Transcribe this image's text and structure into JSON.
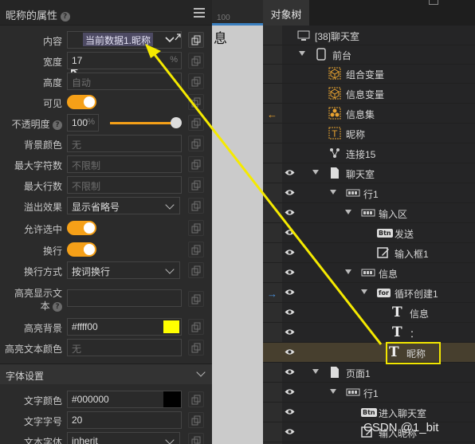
{
  "props": {
    "title": "昵称的属性",
    "rows": {
      "content": {
        "label": "内容",
        "chip": "当前数据1.昵称"
      },
      "width": {
        "label": "宽度",
        "value": "17",
        "unit": "%"
      },
      "height": {
        "label": "高度",
        "placeholder": "自动"
      },
      "visible": {
        "label": "可见"
      },
      "opacity": {
        "label": "不透明度",
        "value": "100",
        "unit": "%",
        "level": 1.0
      },
      "bgcolor": {
        "label": "背景颜色",
        "placeholder": "无"
      },
      "maxchars": {
        "label": "最大字符数",
        "placeholder": "不限制"
      },
      "maxlines": {
        "label": "最大行数",
        "placeholder": "不限制"
      },
      "overflow": {
        "label": "溢出效果",
        "value": "显示省略号"
      },
      "allowsel": {
        "label": "允许选中"
      },
      "wrap": {
        "label": "换行"
      },
      "wrapmode": {
        "label": "换行方式",
        "value": "按词换行"
      },
      "hltext": {
        "label1": "高亮显示文",
        "label2": "本"
      },
      "hlbg": {
        "label": "高亮背景",
        "value": "#ffff00",
        "color": "#ffff00"
      },
      "hlcolor": {
        "label": "高亮文本颜色",
        "placeholder": "无"
      }
    },
    "font_section": "字体设置",
    "fontcolor": {
      "label": "文字颜色",
      "value": "#000000",
      "color": "#000000"
    },
    "fontsize": {
      "label": "文字字号",
      "value": "20"
    },
    "fontfamily": {
      "label": "文本字体",
      "value": "inherit"
    }
  },
  "canvas": {
    "ruler": "100",
    "text": "息"
  },
  "tree": {
    "tab": "对象树",
    "items": [
      {
        "label": "[38]聊天室",
        "icon": "screen-icon"
      },
      {
        "label": "前台",
        "icon": "phone-icon"
      },
      {
        "label": "组合变量",
        "icon": "cube-icon"
      },
      {
        "label": "信息变量",
        "icon": "cube-icon"
      },
      {
        "label": "信息集",
        "icon": "cubes-icon"
      },
      {
        "label": "昵称",
        "icon": "text-var-icon"
      },
      {
        "label": "连接15",
        "icon": "network-icon"
      },
      {
        "label": "聊天室",
        "icon": "page-icon"
      },
      {
        "label": "行1",
        "icon": "row-icon"
      },
      {
        "label": "输入区",
        "icon": "row-icon"
      },
      {
        "label": "发送",
        "icon": "button-icon",
        "badge": "Btn"
      },
      {
        "label": "输入框1",
        "icon": "edit-icon"
      },
      {
        "label": "信息",
        "icon": "row-icon"
      },
      {
        "label": "循环创建1",
        "icon": "loop-icon",
        "badge": "for"
      },
      {
        "label": "信息",
        "icon": "text-icon"
      },
      {
        "label": "：",
        "icon": "text-icon"
      },
      {
        "label": "昵称",
        "icon": "text-icon"
      },
      {
        "label": "页面1",
        "icon": "page-icon"
      },
      {
        "label": "行1",
        "icon": "row-icon"
      },
      {
        "label": "进入聊天室",
        "icon": "button-icon",
        "badge": "Btn"
      },
      {
        "label": "输入昵称",
        "icon": "edit-icon"
      }
    ]
  },
  "watermark": "CSDN @1_bit",
  "accent": "#f5a018",
  "highlight": "#f2e600"
}
